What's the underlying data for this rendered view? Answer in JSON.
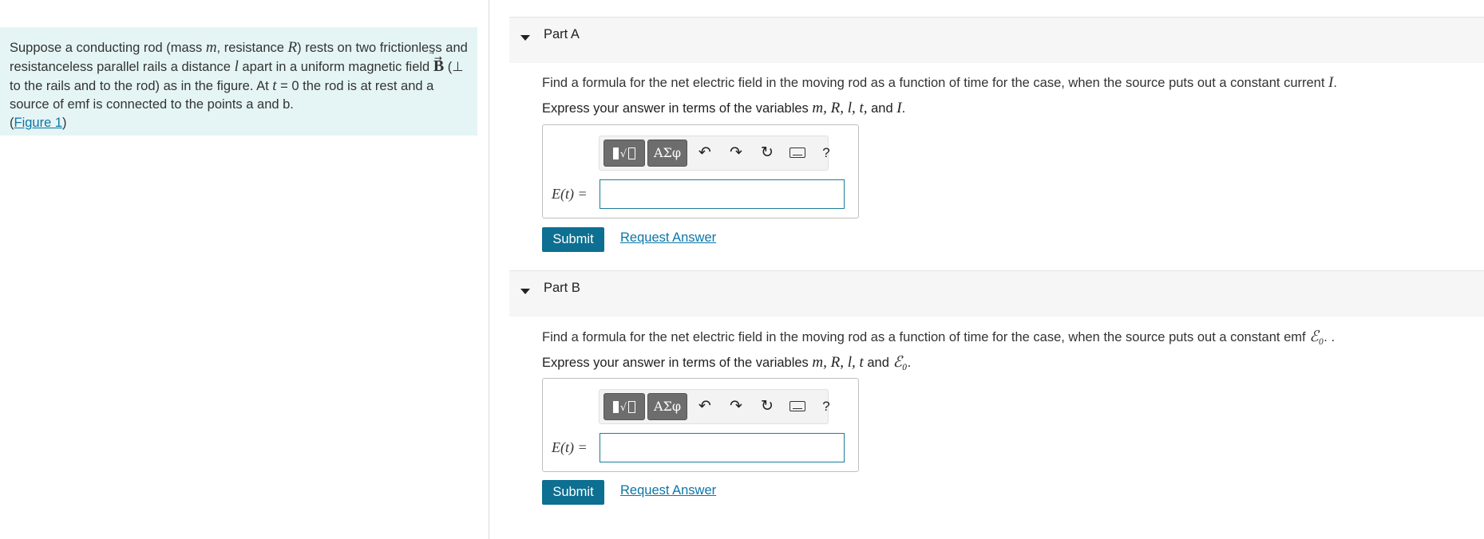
{
  "problem": {
    "intro": "Suppose a conducting rod (mass ",
    "var_m": "m",
    "t2": ", resistance ",
    "var_R": "R",
    "t3": ") rests on two frictionless and resistanceless parallel rails a distance ",
    "var_l": "l",
    "t4": " apart in a uniform magnetic field ",
    "var_B": "B",
    "t5": " (⊥ to the rails and to the rod) as in the figure. At ",
    "var_t": "t",
    "t6": " = 0 the rod is at rest and a source of emf is connected to the points a and b.",
    "figure_open": "(",
    "figure_link": "Figure 1",
    "figure_close": ")"
  },
  "toolbar": {
    "templates_icon": "templates-icon",
    "greek_label": "ΑΣφ",
    "undo_icon": "↶",
    "redo_icon": "↷",
    "reset_icon": "↻",
    "keyboard_icon": "keyboard-icon",
    "help_label": "?"
  },
  "parts": [
    {
      "title": "Part A",
      "prompt": "Find a formula for the net electric field in the moving rod as a function of time for the case, when the source puts out a constant current ",
      "prompt_var": "I",
      "prompt_end": ".",
      "instr": "Express your answer in terms of the variables ",
      "instr_vars": "m, R, l, t,",
      "instr_and": " and ",
      "instr_last": "I",
      "instr_end": ".",
      "eq_label": "E(t) =",
      "input_value": "",
      "submit": "Submit",
      "request": "Request Answer"
    },
    {
      "title": "Part B",
      "prompt": "Find a formula for the net electric field in the moving rod as a function of time for the case, when the source puts out a constant emf ",
      "prompt_var": "ℰ₀",
      "prompt_end": ". .",
      "instr": "Express your answer in terms of the variables ",
      "instr_vars": "m, R, l, t",
      "instr_and": " and ",
      "instr_last": "ℰ₀",
      "instr_end": ".",
      "eq_label": "E(t) =",
      "input_value": "",
      "submit": "Submit",
      "request": "Request Answer"
    }
  ],
  "colors": {
    "problem_bg": "#e5f5f5",
    "submit_bg": "#0d6f91",
    "link": "#0a76a8",
    "input_border": "#1c7d9c"
  }
}
